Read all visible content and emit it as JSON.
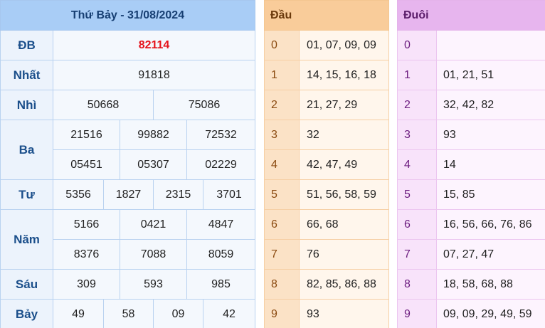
{
  "main": {
    "title": "Thứ Bảy - 31/08/2024",
    "prizes": [
      {
        "label": "ĐB",
        "rows": [
          [
            "82114"
          ]
        ]
      },
      {
        "label": "Nhất",
        "rows": [
          [
            "91818"
          ]
        ]
      },
      {
        "label": "Nhì",
        "rows": [
          [
            "50668",
            "75086"
          ]
        ]
      },
      {
        "label": "Ba",
        "rows": [
          [
            "21516",
            "99882",
            "72532"
          ],
          [
            "05451",
            "05307",
            "02229"
          ]
        ]
      },
      {
        "label": "Tư",
        "rows": [
          [
            "5356",
            "1827",
            "2315",
            "3701"
          ]
        ]
      },
      {
        "label": "Năm",
        "rows": [
          [
            "5166",
            "0421",
            "4847"
          ],
          [
            "8376",
            "7088",
            "8059"
          ]
        ]
      },
      {
        "label": "Sáu",
        "rows": [
          [
            "309",
            "593",
            "985"
          ]
        ]
      },
      {
        "label": "Bảy",
        "rows": [
          [
            "49",
            "58",
            "09",
            "42"
          ]
        ]
      }
    ]
  },
  "dau": {
    "header": "Đầu",
    "rows": [
      {
        "digit": "0",
        "nums": "01, 07, 09, 09"
      },
      {
        "digit": "1",
        "nums": "14, 15, 16, 18"
      },
      {
        "digit": "2",
        "nums": "21, 27, 29"
      },
      {
        "digit": "3",
        "nums": "32"
      },
      {
        "digit": "4",
        "nums": "42, 47, 49"
      },
      {
        "digit": "5",
        "nums": "51, 56, 58, 59"
      },
      {
        "digit": "6",
        "nums": "66, 68"
      },
      {
        "digit": "7",
        "nums": "76"
      },
      {
        "digit": "8",
        "nums": "82, 85, 86, 88"
      },
      {
        "digit": "9",
        "nums": "93"
      }
    ]
  },
  "duoi": {
    "header": "Đuôi",
    "rows": [
      {
        "digit": "0",
        "nums": ""
      },
      {
        "digit": "1",
        "nums": "01, 21, 51"
      },
      {
        "digit": "2",
        "nums": "32, 42, 82"
      },
      {
        "digit": "3",
        "nums": "93"
      },
      {
        "digit": "4",
        "nums": "14"
      },
      {
        "digit": "5",
        "nums": "15, 85"
      },
      {
        "digit": "6",
        "nums": "16, 56, 66, 76, 86"
      },
      {
        "digit": "7",
        "nums": "07, 27, 47"
      },
      {
        "digit": "8",
        "nums": "18, 58, 68, 88"
      },
      {
        "digit": "9",
        "nums": "09, 09, 29, 49, 59"
      }
    ]
  },
  "colors": {
    "main_header_bg": "#a9cdf6",
    "special_prize_text": "#e5131c",
    "dau_header_bg": "#f9cc9a",
    "duoi_header_bg": "#e7b5ee"
  }
}
